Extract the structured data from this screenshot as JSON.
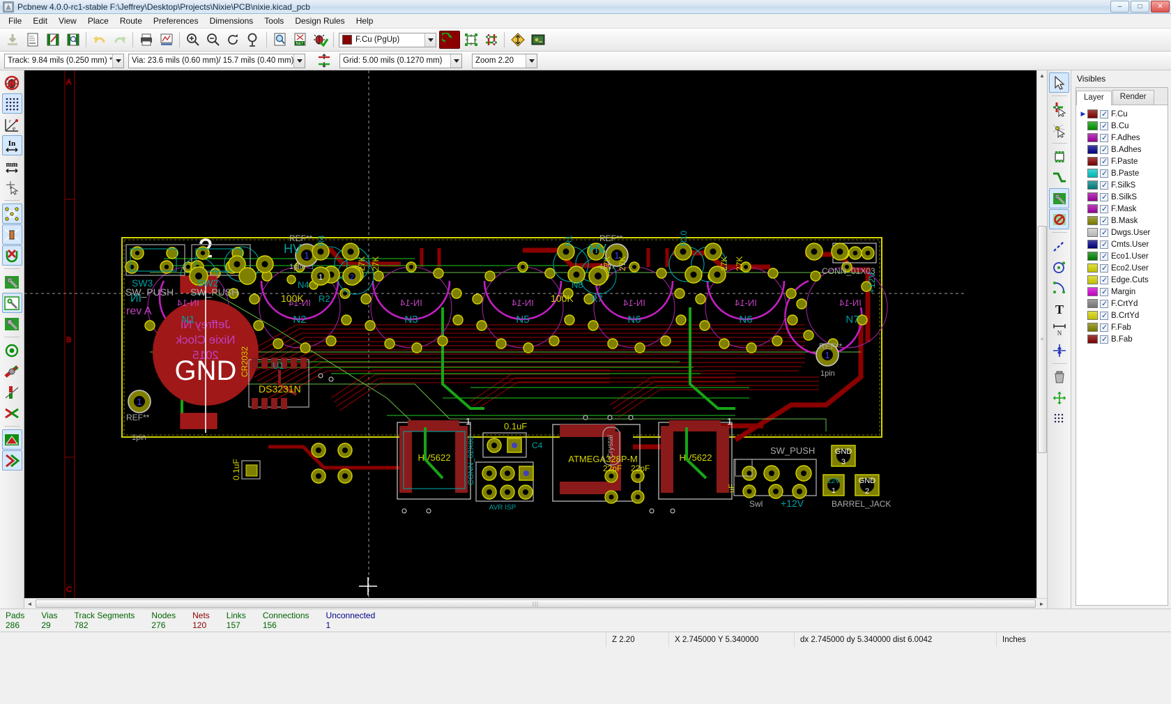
{
  "window": {
    "title": "Pcbnew 4.0.0-rc1-stable F:\\Jeffrey\\Desktop\\Projects\\Nixie\\PCB\\nixie.kicad_pcb",
    "app_icon": "pcbnew-icon",
    "minimize": "–",
    "maximize": "□",
    "close": "✕"
  },
  "menubar": {
    "items": [
      {
        "label": "File"
      },
      {
        "label": "Edit"
      },
      {
        "label": "View"
      },
      {
        "label": "Place"
      },
      {
        "label": "Route"
      },
      {
        "label": "Preferences"
      },
      {
        "label": "Dimensions"
      },
      {
        "label": "Tools"
      },
      {
        "label": "Design Rules"
      },
      {
        "label": "Help"
      }
    ]
  },
  "toolbar_main": {
    "buttons": [
      {
        "name": "new-board-icon",
        "tip": "New board"
      },
      {
        "name": "open-board-icon",
        "tip": "Open existing board"
      },
      {
        "name": "save-board-icon",
        "tip": "Save board"
      },
      {
        "name": "page-settings-icon",
        "tip": "Page settings"
      },
      {
        "name": "open-module-editor-icon",
        "tip": "Open module editor"
      },
      {
        "name": "open-module-viewer-icon",
        "tip": "Open module viewer"
      },
      {
        "name": "undo-icon",
        "tip": "Undo"
      },
      {
        "name": "redo-icon",
        "tip": "Redo"
      },
      {
        "name": "print-board-icon",
        "tip": "Print board"
      },
      {
        "name": "plot-icon",
        "tip": "Plot (HPGL, PostScript, or GERBER format)"
      },
      {
        "name": "zoom-in-icon",
        "tip": "Zoom in"
      },
      {
        "name": "zoom-out-icon",
        "tip": "Zoom out"
      },
      {
        "name": "zoom-redraw-icon",
        "tip": "Redraw view"
      },
      {
        "name": "zoom-fit-icon",
        "tip": "Zoom auto"
      },
      {
        "name": "find-icon",
        "tip": "Find components and text"
      },
      {
        "name": "netlist-icon",
        "tip": "Read netlist"
      },
      {
        "name": "drc-icon",
        "tip": "Perform design rules check"
      },
      {
        "name": "mode-module-icon",
        "tip": "Mode footprint"
      },
      {
        "name": "mode-track-icon",
        "tip": "Mode track and autorouting"
      },
      {
        "name": "show-ratsnest-icon",
        "tip": "Show board ratsnest"
      },
      {
        "name": "highlight-net-icon",
        "tip": "Highlight net"
      },
      {
        "name": "3d-view-icon",
        "tip": "3D Display"
      }
    ],
    "layer_select": {
      "value": "F.Cu (PgUp)",
      "color": "#8b0000"
    }
  },
  "toolbar_aux": {
    "track_width": {
      "value": "Track: 9.84 mils (0.250 mm) *"
    },
    "via_size": {
      "value": "Via: 23.6 mils (0.60 mm)/ 15.7 mils (0.40 mm) *"
    },
    "auto_width_icon": "auto-track-width-icon",
    "grid": {
      "value": "Grid: 5.00 mils (0.1270 mm)"
    },
    "zoom": {
      "value": "Zoom 2.20"
    }
  },
  "left_toolbar": {
    "buttons": [
      {
        "name": "drc-off-icon",
        "active": false
      },
      {
        "name": "grid-visibility-icon",
        "active": true
      },
      {
        "name": "polar-coords-icon",
        "active": false
      },
      {
        "name": "units-inch-icon",
        "active": true,
        "label": "In"
      },
      {
        "name": "units-mm-icon",
        "active": false,
        "label": "mm"
      },
      {
        "name": "cursor-shape-icon",
        "active": false
      },
      {
        "name": "show-ratsnest-icon",
        "active": true
      },
      {
        "name": "show-module-ratsnest-icon",
        "active": true
      },
      {
        "name": "auto-delete-track-icon",
        "active": true
      },
      {
        "name": "show-zones-icon",
        "active": false
      },
      {
        "name": "show-zones-outline-icon",
        "active": true
      },
      {
        "name": "show-zones-disable-icon",
        "active": false
      },
      {
        "name": "via-sketch-icon",
        "active": false
      },
      {
        "name": "track-sketch-icon",
        "active": false
      },
      {
        "name": "high-contrast-icon",
        "active": false
      },
      {
        "name": "layer-alignment-icon",
        "active": false
      },
      {
        "name": "show-footprint-text-icon",
        "active": true
      },
      {
        "name": "show-pads-outline-icon",
        "active": true
      }
    ]
  },
  "right_toolbar": {
    "buttons": [
      {
        "name": "cursor-select-icon",
        "active": true
      },
      {
        "name": "highlight-net-tool-icon",
        "active": false
      },
      {
        "name": "local-ratsnest-icon",
        "active": false
      },
      {
        "name": "add-footprint-icon",
        "active": false
      },
      {
        "name": "add-track-icon",
        "active": false
      },
      {
        "name": "add-zone-icon",
        "active": false
      },
      {
        "name": "add-keepout-zone-icon",
        "active": false
      },
      {
        "name": "add-line-icon",
        "active": false
      },
      {
        "name": "add-circle-icon",
        "active": false
      },
      {
        "name": "add-arc-icon",
        "active": false
      },
      {
        "name": "add-text-icon",
        "active": false
      },
      {
        "name": "add-dimension-icon",
        "active": false
      },
      {
        "name": "add-mire-target-icon",
        "active": false
      },
      {
        "name": "delete-item-icon",
        "active": false
      },
      {
        "name": "set-origin-icon",
        "active": false
      },
      {
        "name": "set-grid-origin-icon",
        "active": false
      }
    ]
  },
  "layers_panel": {
    "title": "Visibles",
    "tabs": [
      {
        "label": "Layer",
        "active": true
      },
      {
        "label": "Render",
        "active": false
      }
    ],
    "layers": [
      {
        "name": "F.Cu",
        "color": "#840000",
        "visible": true,
        "selected": true
      },
      {
        "name": "B.Cu",
        "color": "#009900",
        "visible": true,
        "selected": false
      },
      {
        "name": "F.Adhes",
        "color": "#a400a4",
        "visible": true,
        "selected": false
      },
      {
        "name": "B.Adhes",
        "color": "#00008b",
        "visible": true,
        "selected": false
      },
      {
        "name": "F.Paste",
        "color": "#840000",
        "visible": true,
        "selected": false
      },
      {
        "name": "B.Paste",
        "color": "#00c8c8",
        "visible": true,
        "selected": false
      },
      {
        "name": "F.SilkS",
        "color": "#008484",
        "visible": true,
        "selected": false
      },
      {
        "name": "B.SilkS",
        "color": "#a400a4",
        "visible": true,
        "selected": false
      },
      {
        "name": "F.Mask",
        "color": "#a400a4",
        "visible": true,
        "selected": false
      },
      {
        "name": "B.Mask",
        "color": "#848400",
        "visible": true,
        "selected": false
      },
      {
        "name": "Dwgs.User",
        "color": "#c8c8c8",
        "visible": true,
        "selected": false
      },
      {
        "name": "Cmts.User",
        "color": "#000084",
        "visible": true,
        "selected": false
      },
      {
        "name": "Eco1.User",
        "color": "#008400",
        "visible": true,
        "selected": false
      },
      {
        "name": "Eco2.User",
        "color": "#d4d400",
        "visible": true,
        "selected": false
      },
      {
        "name": "Edge.Cuts",
        "color": "#d4d400",
        "visible": true,
        "selected": false
      },
      {
        "name": "Margin",
        "color": "#d400d4",
        "visible": true,
        "selected": false
      },
      {
        "name": "F.CrtYd",
        "color": "#808080",
        "visible": true,
        "selected": false
      },
      {
        "name": "B.CrtYd",
        "color": "#d4d400",
        "visible": true,
        "selected": false
      },
      {
        "name": "F.Fab",
        "color": "#848400",
        "visible": true,
        "selected": false
      },
      {
        "name": "B.Fab",
        "color": "#840000",
        "visible": true,
        "selected": false
      }
    ]
  },
  "stats_bar": {
    "items": [
      {
        "label": "Pads",
        "value": "286",
        "color": "#006400"
      },
      {
        "label": "Vias",
        "value": "29",
        "color": "#006400"
      },
      {
        "label": "Track Segments",
        "value": "782",
        "color": "#006400"
      },
      {
        "label": "Nodes",
        "value": "276",
        "color": "#006400"
      },
      {
        "label": "Nets",
        "value": "120",
        "color": "#8b0000"
      },
      {
        "label": "Links",
        "value": "157",
        "color": "#006400"
      },
      {
        "label": "Connections",
        "value": "156",
        "color": "#006400"
      },
      {
        "label": "Unconnected",
        "value": "1",
        "color": "#00008b"
      }
    ]
  },
  "status_bar": {
    "zoom": "Z 2.20",
    "abs_coord": "X 2.745000   Y 5.340000",
    "rel_coord": "dx 2.745000   dy 5.340000   dist 6.0042",
    "units": "Inches"
  },
  "board": {
    "silkscreen_texts": [
      "SW3",
      "SW_PUSH",
      "SW2",
      "SW_PUSH",
      "IN",
      "rev A",
      "Jeffrey Ni",
      "Nixie Clock",
      "2015",
      "GND",
      "2",
      "REF**",
      "1pin",
      "1",
      "CR2032",
      "U1",
      "DS3231N",
      "0.1uF",
      "N1",
      "N2",
      "N3",
      "N4",
      "N5",
      "N6",
      "N7",
      "N8",
      "IN-14",
      "HV",
      "100K",
      "R2",
      "R7",
      "27K",
      "R1",
      "R4",
      "R10",
      "HV5622",
      "CONN_02X03",
      "ATMEGA328P-M",
      "AVR ISP",
      "Crystal",
      "22pF",
      "0.1uF",
      "C4",
      "CONN_01X03",
      "SW_PUSH",
      "BARREL_JACK",
      "GND 3",
      "GND 2",
      "+12V",
      "Swl",
      "+12V"
    ],
    "grid_marks": [
      "A",
      "B",
      "C"
    ]
  }
}
